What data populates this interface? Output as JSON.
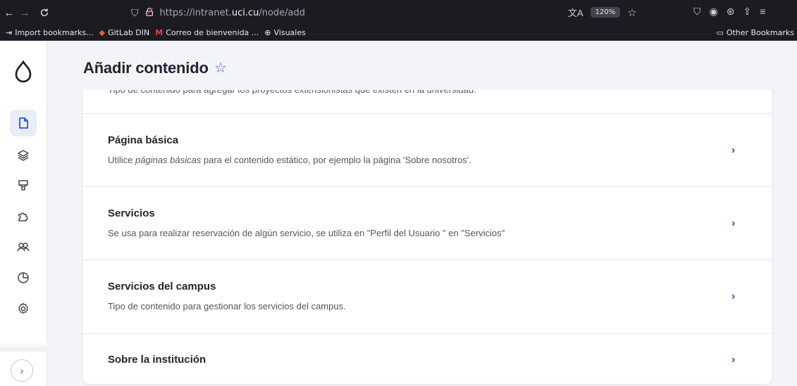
{
  "browser": {
    "url_prefix": "https://intranet.",
    "url_domain": "uci.cu",
    "url_path": "/node/add",
    "zoom": "120%",
    "bookmarks": [
      {
        "icon": "import-icon",
        "label": "Import bookmarks..."
      },
      {
        "icon": "gitlab-icon",
        "label": "GitLab DIN"
      },
      {
        "icon": "gmail-icon",
        "label": "Correo de bienvenida ..."
      },
      {
        "icon": "globe-icon",
        "label": "Visuales"
      }
    ],
    "other_bookmarks": "Other Bookmarks"
  },
  "page": {
    "title": "Añadir contenido"
  },
  "content_types": {
    "partial_desc": "Tipo de contenido para agregar los proyectos extensionistas que existen en la universidad.",
    "items": [
      {
        "name": "Página básica",
        "desc_before": "Utilice ",
        "desc_em": "páginas básicas",
        "desc_after": " para el contenido estático, por ejemplo la página 'Sobre nosotros'."
      },
      {
        "name": "Servicios",
        "desc": "Se usa para realizar reservación de algún servicio, se utiliza en \"Perfil del Usuario \" en \"Servicios\""
      },
      {
        "name": "Servicios del campus",
        "desc": "Tipo de contenido para gestionar los servicios del campus."
      },
      {
        "name": "Sobre la institución",
        "desc": ""
      }
    ]
  },
  "colors": {
    "accent": "#2f56c4",
    "chrome_bg": "#1c1b22",
    "page_bg": "#f3f4f7"
  }
}
